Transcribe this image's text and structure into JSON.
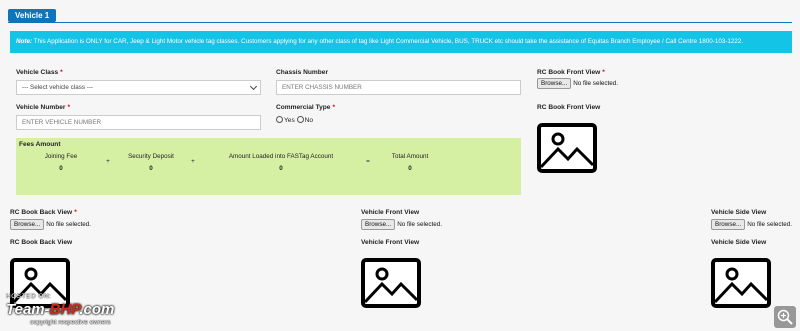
{
  "section_badge": "Vehicle 1",
  "note": {
    "prefix": "Note:",
    "text": "This Application is ONLY for CAR, Jeep & Light Motor vehicle tag classes. Customers applying for any other class of tag like Light Commercial Vehicle, BUS, TRUCK etc should take the assistance of Equitas Branch Employee / Call Centre 1800-103-1222."
  },
  "form": {
    "vehicle_class": {
      "label": "Vehicle Class",
      "required_mark": "*",
      "value": "--- Select vehicle class ---"
    },
    "chassis_number": {
      "label": "Chassis Number",
      "placeholder": "ENTER CHASSIS NUMBER"
    },
    "vehicle_number": {
      "label": "Vehicle Number",
      "required_mark": "*",
      "placeholder": "ENTER VEHICLE NUMBER"
    },
    "commercial_type": {
      "label": "Commercial Type",
      "required_mark": "*",
      "options": [
        "Yes",
        "No"
      ]
    }
  },
  "fees": {
    "title": "Fees Amount",
    "columns": [
      {
        "label": "Joining Fee",
        "value": "0"
      },
      {
        "label": "Security Deposit",
        "value": "0"
      },
      {
        "label": "Amount Loaded into FASTag Account",
        "value": "0"
      },
      {
        "label": "Total Amount",
        "value": "0"
      }
    ],
    "operators": [
      "+",
      "+",
      "="
    ]
  },
  "uploads": {
    "rc_front": {
      "label": "RC Book Front View",
      "required_mark": "*",
      "browse": "Browse...",
      "status": "No file selected.",
      "preview_label": "RC Book Front View",
      "icon": "image-placeholder-icon"
    },
    "rc_back": {
      "label": "RC Book Back View",
      "required_mark": "*",
      "browse": "Browse...",
      "status": "No file selected.",
      "preview_label": "RC Book Back View",
      "icon": "image-placeholder-icon"
    },
    "vehicle_front": {
      "label": "Vehicle Front View",
      "browse": "Browse...",
      "status": "No file selected.",
      "preview_label": "Vehicle Front View",
      "icon": "image-placeholder-icon"
    },
    "vehicle_side": {
      "label": "Vehicle Side View",
      "browse": "Browse...",
      "status": "No file selected.",
      "preview_label": "Vehicle Side View",
      "icon": "image-placeholder-icon"
    }
  },
  "watermark": {
    "line1": "HOSTED ON:",
    "brand_a": "Team-",
    "brand_b": "BHP",
    "brand_c": ".com",
    "line3": "copyright respective owners"
  },
  "colors": {
    "badge": "#1173b8",
    "note_bg": "#14c4e6",
    "fees_bg": "#d6f0a3",
    "required": "#dd0000"
  },
  "zoom_icon": "magnifier-plus-icon"
}
